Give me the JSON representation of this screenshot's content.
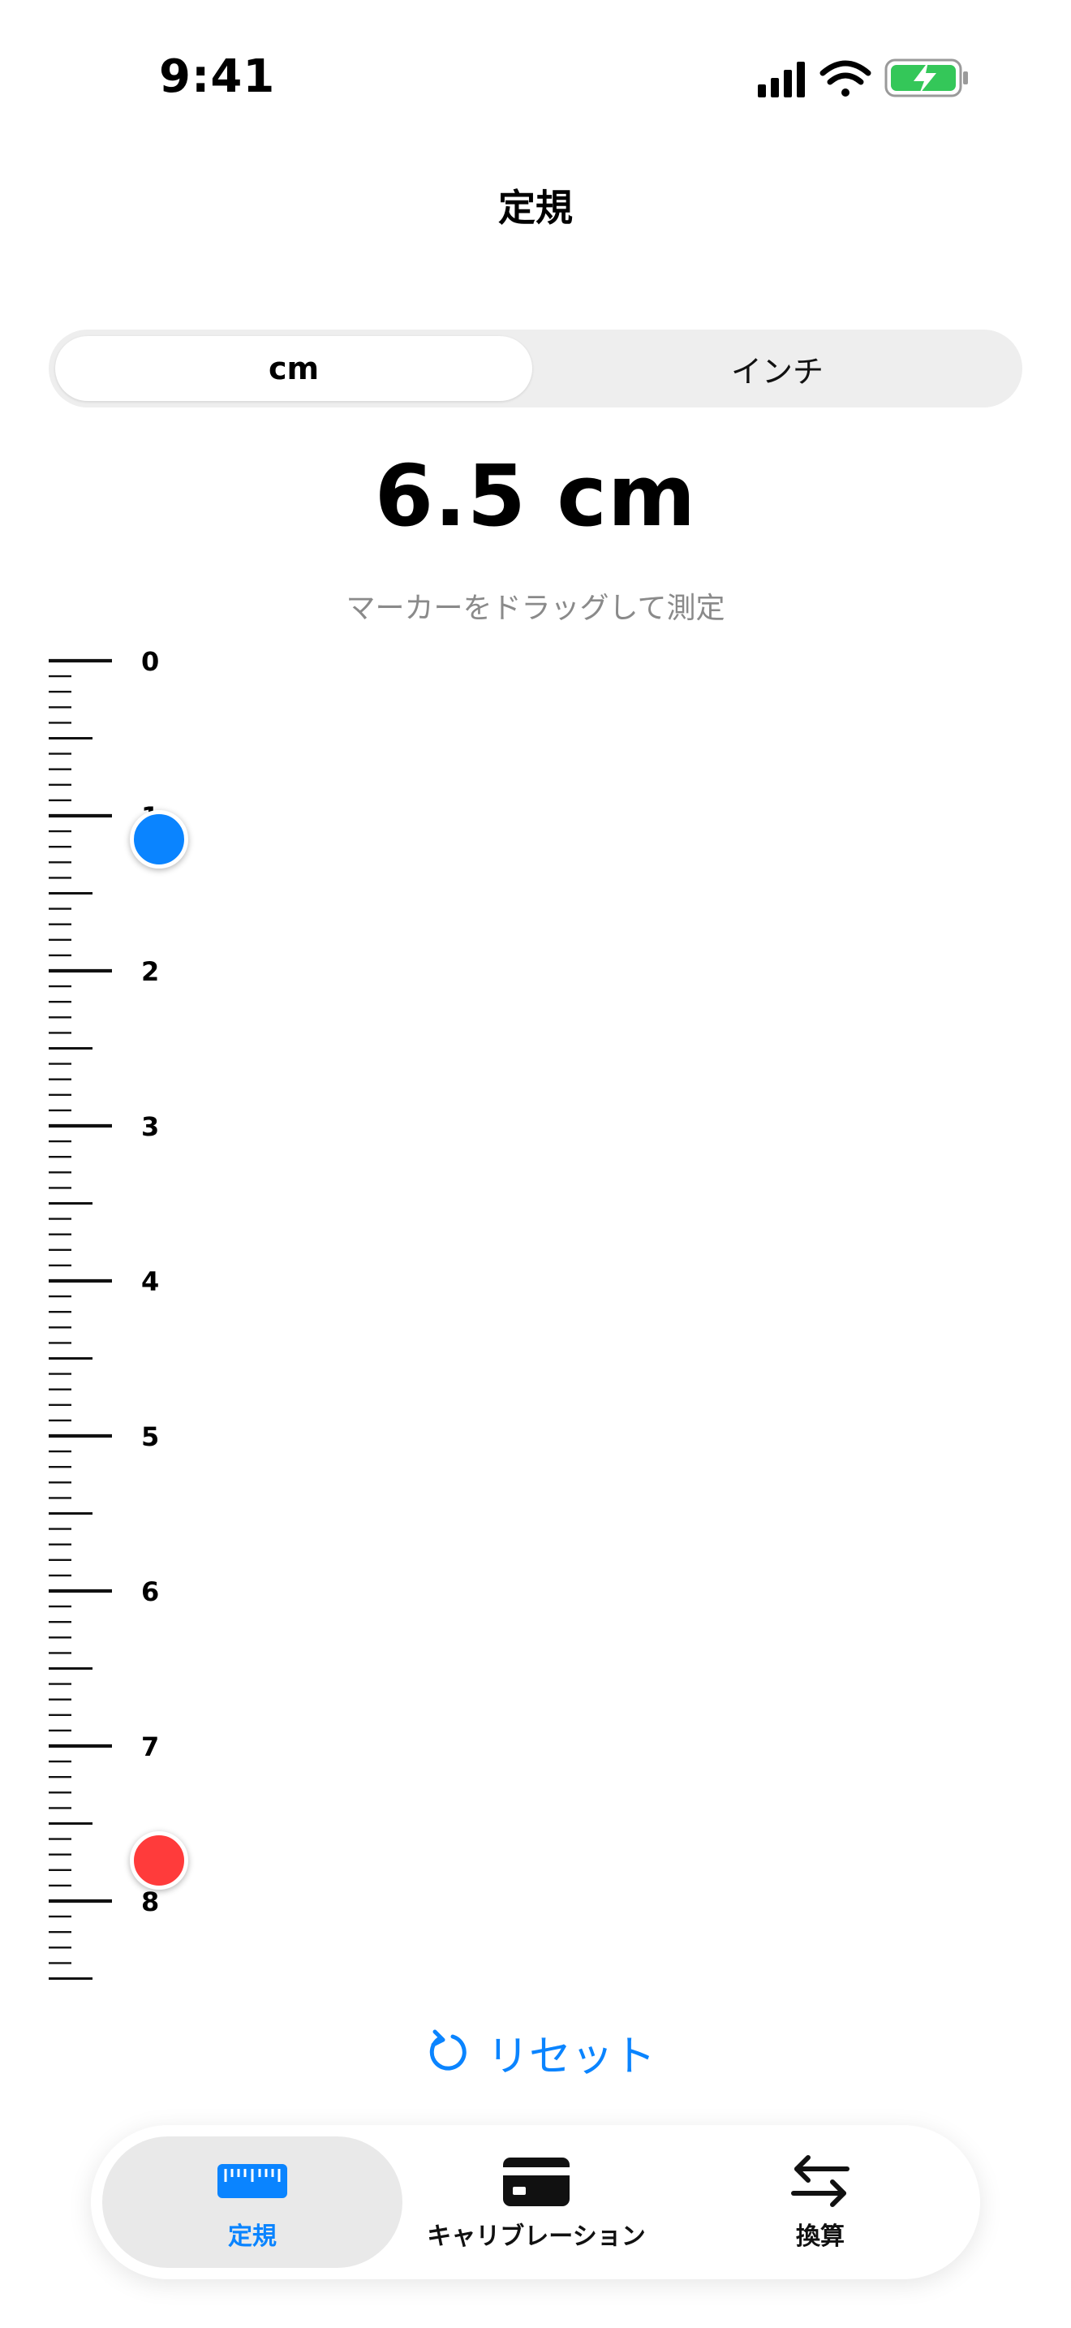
{
  "status_bar": {
    "time": "9:41"
  },
  "header": {
    "title": "定規"
  },
  "unit_toggle": {
    "cm_label": "cm",
    "inch_label": "インチ",
    "selected": "cm"
  },
  "measurement": {
    "value": "6.5 cm",
    "hint": "マーカーをドラッグして測定"
  },
  "ruler": {
    "labels": [
      "0",
      "1",
      "2",
      "3",
      "4",
      "5",
      "6",
      "7",
      "8"
    ],
    "start_cm": 1.2,
    "end_cm": 7.7
  },
  "actions": {
    "reset_label": "リセット"
  },
  "tab_bar": {
    "tabs": [
      {
        "label": "定規",
        "icon": "ruler-icon",
        "active": true
      },
      {
        "label": "キャリブレーション",
        "icon": "card-icon",
        "active": false
      },
      {
        "label": "換算",
        "icon": "convert-arrows-icon",
        "active": false
      }
    ]
  },
  "colors": {
    "accent": "#0a84ff",
    "start_marker": "#0a84ff",
    "end_marker": "#ff3b3b",
    "battery": "#34c759"
  }
}
